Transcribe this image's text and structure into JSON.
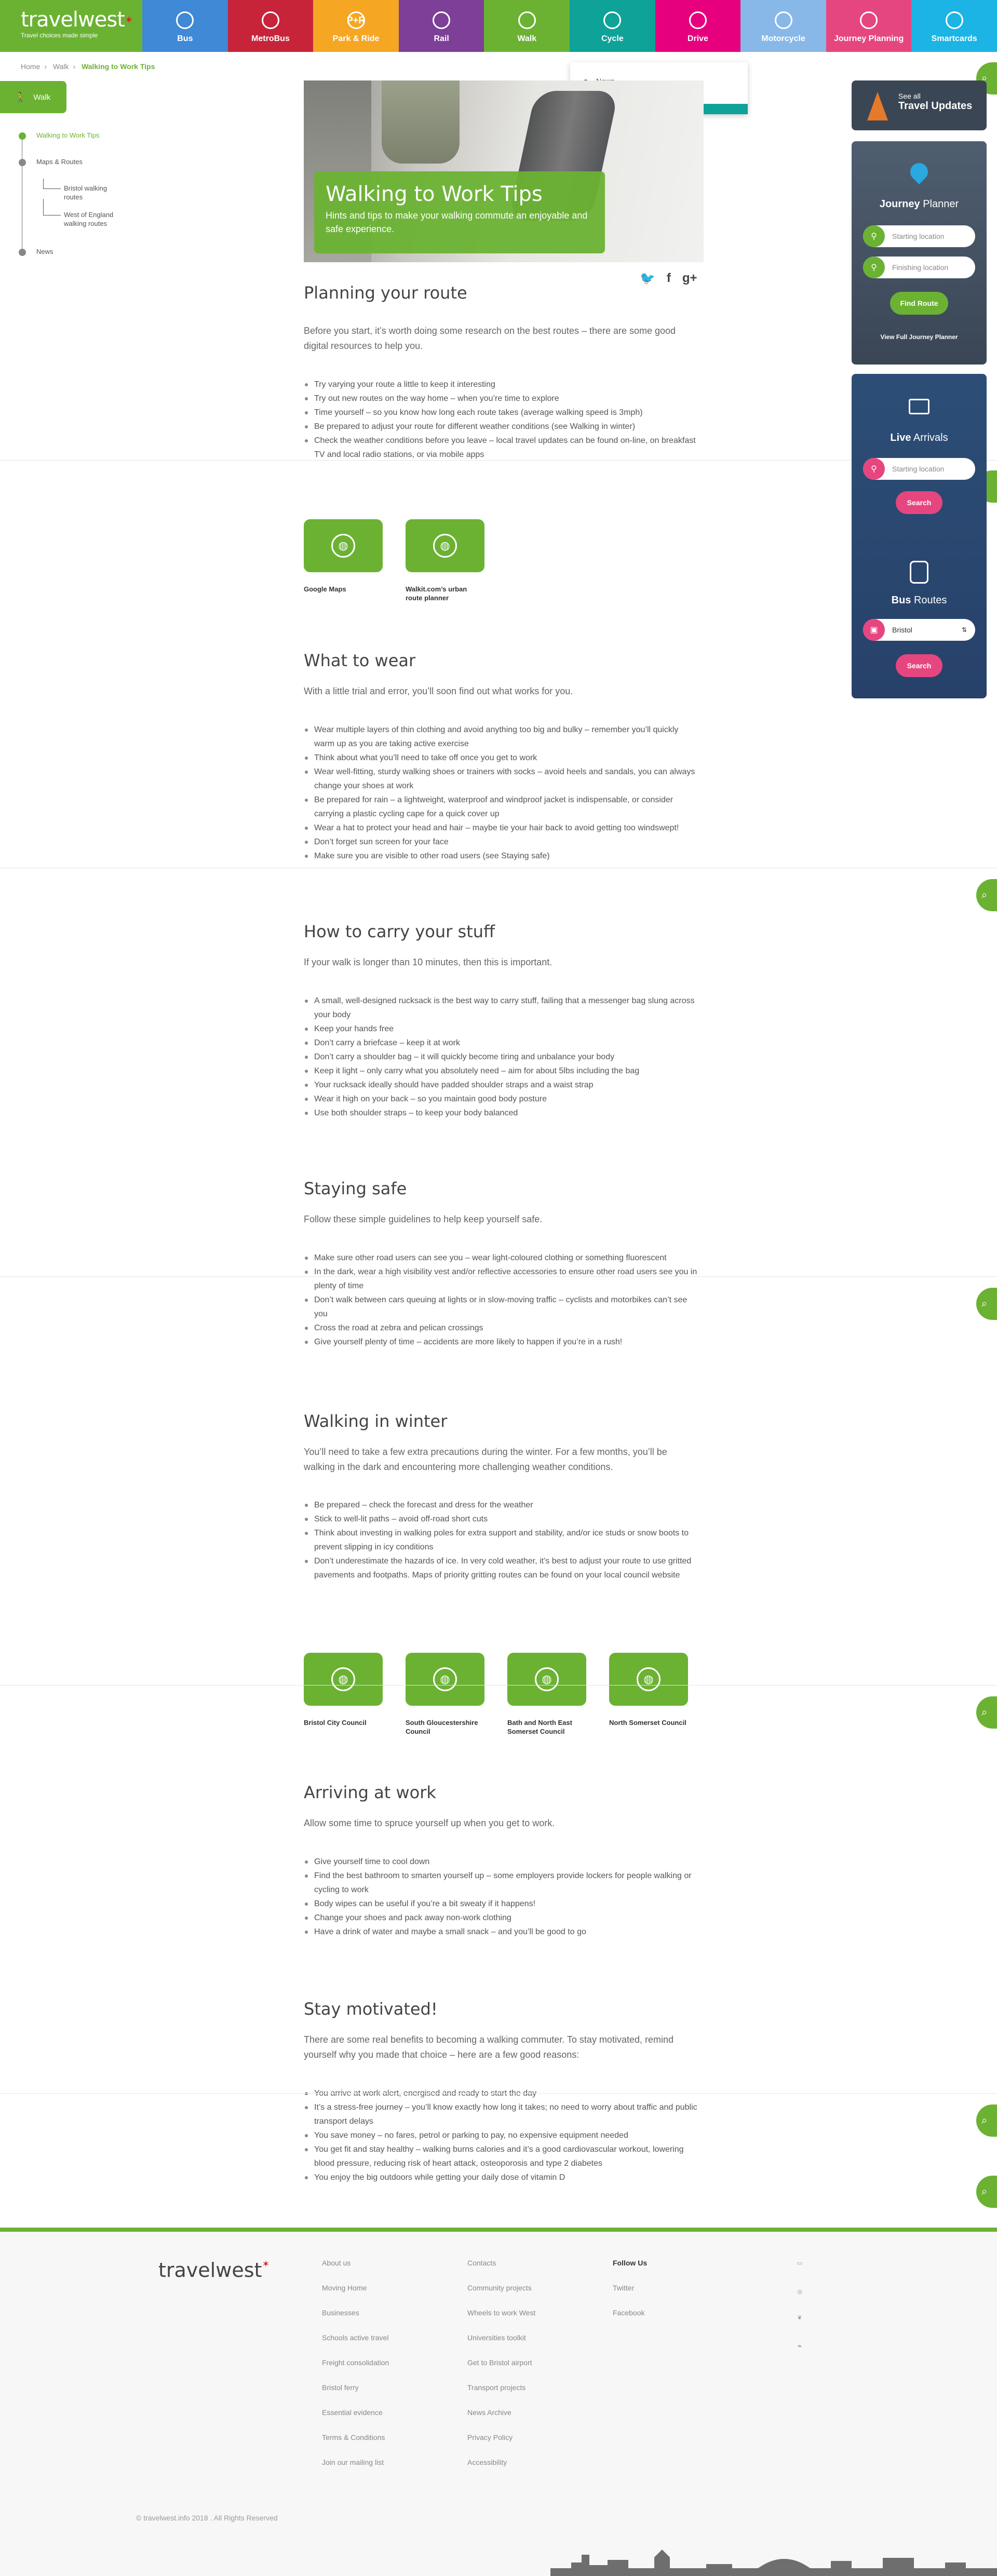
{
  "header": {
    "logo": "travelwest",
    "tagline": "Travel choices made simple",
    "nav": [
      {
        "label": "Bus",
        "icon": "bus-icon",
        "color": "#3f89d6"
      },
      {
        "label": "MetroBus",
        "icon": "metrobus-icon",
        "color": "#c7243a"
      },
      {
        "label": "Park & Ride",
        "icon": "park-ride-icon",
        "color": "#f5a623",
        "icon_text": "P+R"
      },
      {
        "label": "Rail",
        "icon": "rail-icon",
        "color": "#7d3f98"
      },
      {
        "label": "Walk",
        "icon": "walk-icon",
        "color": "#6bb233"
      },
      {
        "label": "Cycle",
        "icon": "cycle-icon",
        "color": "#0fa298"
      },
      {
        "label": "Drive",
        "icon": "car-icon",
        "color": "#e6007e"
      },
      {
        "label": "Motorcycle",
        "icon": "motorcycle-icon",
        "color": "#88b8e8"
      },
      {
        "label": "Journey Planning",
        "icon": "location-icon",
        "color": "#e6467f"
      },
      {
        "label": "Smartcards",
        "icon": "smartcard-icon",
        "color": "#1cb4e4"
      }
    ]
  },
  "breadcrumb": [
    "Home",
    "Walk",
    "Walking to Work Tips"
  ],
  "walk_button": "Walk",
  "sidenav": {
    "items": [
      "Walking to Work Tips",
      "Maps & Routes",
      "Bristol walking routes",
      "West of England walking routes",
      "News"
    ]
  },
  "news_popup": "News",
  "hero": {
    "title": "Walking to Work Tips",
    "subtitle": "Hints and tips to make your walking commute an enjoyable and safe experience."
  },
  "share": [
    "twitter-icon",
    "facebook-icon",
    "google-plus-icon"
  ],
  "sections": {
    "planning": {
      "title": "Planning your route",
      "intro": "Before you start, it’s worth doing some research on the best routes – there are some good digital resources to help you.",
      "bullets": [
        "Try varying your route a little to keep it interesting",
        "Try out new routes on the way home – when you’re time to explore",
        "Time yourself – so you know how long each route takes (average walking speed is 3mph)",
        "Be prepared to adjust your route for different weather conditions (see Walking in winter)",
        "Check the weather conditions before you leave – local travel updates can be found on-line, on breakfast TV and local radio stations, or via mobile apps"
      ],
      "tiles": [
        "Google Maps",
        "Walkit.com’s urban route planner"
      ]
    },
    "wear": {
      "title": "What to wear",
      "intro": "With a little trial and error, you’ll soon find out what works for you.",
      "bullets": [
        "Wear multiple layers of thin clothing and avoid anything too big and bulky – remember you’ll quickly warm up as you are taking active exercise",
        "Think about what you’ll need to take off once you get to work",
        "Wear well-fitting, sturdy walking shoes or trainers with socks – avoid heels and sandals, you can always change your shoes at work",
        "Be prepared for rain – a lightweight, waterproof and windproof jacket is indispensable, or consider carrying a plastic cycling cape for a quick cover up",
        "Wear a hat to protect your head and hair – maybe tie your hair back to avoid getting too windswept!",
        "Don’t forget sun screen for your face",
        "Make sure you are visible to other road users (see Staying safe)"
      ]
    },
    "carry": {
      "title": "How to carry your stuff",
      "intro": "If your walk is longer than 10 minutes, then this is important.",
      "bullets": [
        "A small, well-designed rucksack is the best way to carry stuff, failing that a messenger bag slung across your body",
        "Keep your hands free",
        "Don’t carry a briefcase – keep it at work",
        "Don’t carry a shoulder bag – it will quickly become tiring and unbalance your body",
        "Keep it light – only carry what you absolutely need – aim for about 5lbs including the bag",
        "Your rucksack ideally should have padded shoulder straps and a waist strap",
        "Wear it high on your back – so you maintain good body posture",
        "Use both shoulder straps – to keep your body balanced"
      ]
    },
    "safe": {
      "title": "Staying safe",
      "intro": "Follow these simple guidelines to help keep yourself safe.",
      "bullets": [
        "Make sure other road users can see you – wear light-coloured clothing or something fluorescent",
        "In the dark, wear a high visibility vest and/or reflective accessories to ensure other road users see you in plenty of time",
        "Don’t walk between cars queuing at lights or in slow-moving traffic – cyclists and motorbikes can’t see you",
        "Cross the road at zebra and pelican crossings",
        "Give yourself plenty of time – accidents are more likely to happen if you’re in a rush!"
      ]
    },
    "winter": {
      "title": "Walking in winter",
      "intro": "You’ll need to take a few extra precautions during the winter. For a few months, you’ll be walking in the dark and encountering more challenging weather conditions.",
      "bullets": [
        "Be prepared – check the forecast and dress for the weather",
        "Stick to well-lit paths – avoid off-road short cuts",
        "Think about investing in walking poles for extra support and stability, and/or ice studs or snow boots to prevent slipping in icy conditions",
        "Don’t underestimate the hazards of ice. In very cold weather, it’s best to adjust your route to use gritted pavements and footpaths. Maps of priority gritting routes can be found on your local council website"
      ],
      "tiles": [
        "Bristol City Council",
        "South Gloucestershire Council",
        "Bath and North East Somerset Council",
        "North Somerset Council"
      ]
    },
    "arriving": {
      "title": "Arriving at work",
      "intro": "Allow some time to spruce yourself up when you get to work.",
      "bullets": [
        "Give yourself time to cool down",
        "Find the best bathroom to smarten yourself up – some employers provide lockers for people walking or cycling to work",
        "Body wipes can be useful if you’re a bit sweaty if it happens!",
        "Change your shoes and pack away non-work clothing",
        "Have a drink of water and maybe a small snack – and you’ll be good to go"
      ]
    },
    "motivated": {
      "title": "Stay motivated!",
      "intro": "There are some real benefits to becoming a walking commuter. To stay motivated, remind yourself why you made that choice – here are a few good reasons:",
      "bullets": [
        "You arrive at work alert, energised and ready to start the day",
        "It’s a stress-free journey – you’ll know exactly how long it takes; no need to worry about traffic and public transport delays",
        "You save money – no fares, petrol or parking to pay, no expensive equipment needed",
        "You get fit and stay healthy – walking burns calories and it’s a good cardiovascular workout, lowering blood pressure, reducing risk of heart attack, osteoporosis and type 2 diabetes",
        "You enjoy the big outdoors while getting your daily dose of vitamin D"
      ]
    }
  },
  "widgets": {
    "updates": {
      "small": "See all",
      "big": "Travel Updates"
    },
    "planner": {
      "title_bold": "Journey",
      "title": "Planner",
      "start": "Starting location",
      "finish": "Finishing location",
      "button": "Find Route",
      "link": "View Full Journey Planner"
    },
    "arrivals": {
      "title_bold": "Live",
      "title": "Arrivals",
      "start": "Starting location",
      "button": "Search"
    },
    "bus_routes": {
      "title_bold": "Bus",
      "title": "Routes",
      "selected": "Bristol",
      "button": "Search"
    }
  },
  "footer": {
    "logo": "travelwest",
    "col1": [
      "About us",
      "Moving Home",
      "Businesses",
      "Schools active travel",
      "Freight consolidation",
      "Bristol ferry",
      "Essential evidence",
      "Terms & Conditions",
      "Join our mailing list"
    ],
    "col2": [
      "Contacts",
      "Community projects",
      "Wheels to work West",
      "Universities toolkit",
      "Get to Bristol airport",
      "Transport projects",
      "News Archive",
      "Privacy Policy",
      "Accessibility"
    ],
    "col3_title": "Follow Us",
    "col3": [
      "Twitter",
      "Facebook"
    ],
    "copyright": "© travelwest.info 2018 . All Rights Reserved"
  }
}
